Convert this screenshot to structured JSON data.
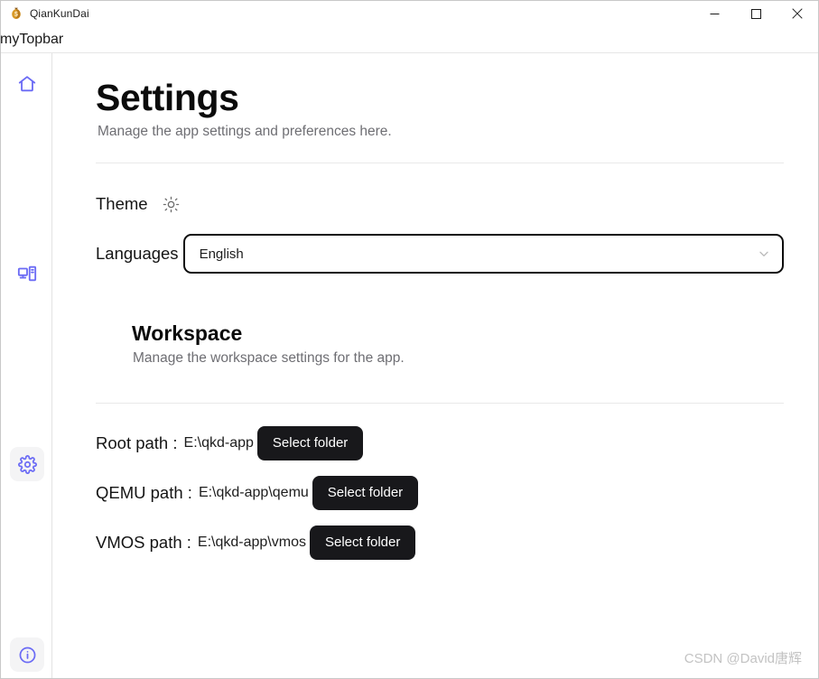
{
  "window": {
    "app_title": "QianKunDai",
    "app_icon": "money-bag-icon",
    "minimize_label": "Minimize",
    "maximize_label": "Maximize",
    "close_label": "Close"
  },
  "topbar": {
    "label": "myTopbar"
  },
  "sidebar": {
    "items": [
      {
        "name": "home",
        "icon": "home-icon",
        "active": false
      },
      {
        "name": "devices",
        "icon": "desktop-computer-icon",
        "active": false
      },
      {
        "name": "settings",
        "icon": "gear-icon",
        "active": true
      },
      {
        "name": "info",
        "icon": "info-circle-icon",
        "active": true
      }
    ],
    "accent_color": "#6b6bf5",
    "active_bg": "#f4f4f5"
  },
  "main": {
    "title": "Settings",
    "subtitle": "Manage the app settings and preferences here.",
    "theme": {
      "label": "Theme",
      "icon": "sun-icon"
    },
    "languages": {
      "label": "Languages",
      "selected": "English",
      "chevron": "chevron-down-icon"
    },
    "workspace": {
      "title": "Workspace",
      "subtitle": "Manage the workspace settings for the app."
    },
    "paths": [
      {
        "label": "Root path :",
        "value": "E:\\qkd-app",
        "button": "Select folder"
      },
      {
        "label": "QEMU path :",
        "value": "E:\\qkd-app\\qemu",
        "button": "Select folder"
      },
      {
        "label": "VMOS path :",
        "value": "E:\\qkd-app\\vmos",
        "button": "Select folder"
      }
    ]
  },
  "watermark": {
    "text": "CSDN @David唐辉"
  },
  "colors": {
    "accent": "#6b6bf5",
    "button_dark": "#18181b",
    "text_primary": "#141414",
    "text_muted": "#6e6e73",
    "divider": "#e9e9e9"
  }
}
